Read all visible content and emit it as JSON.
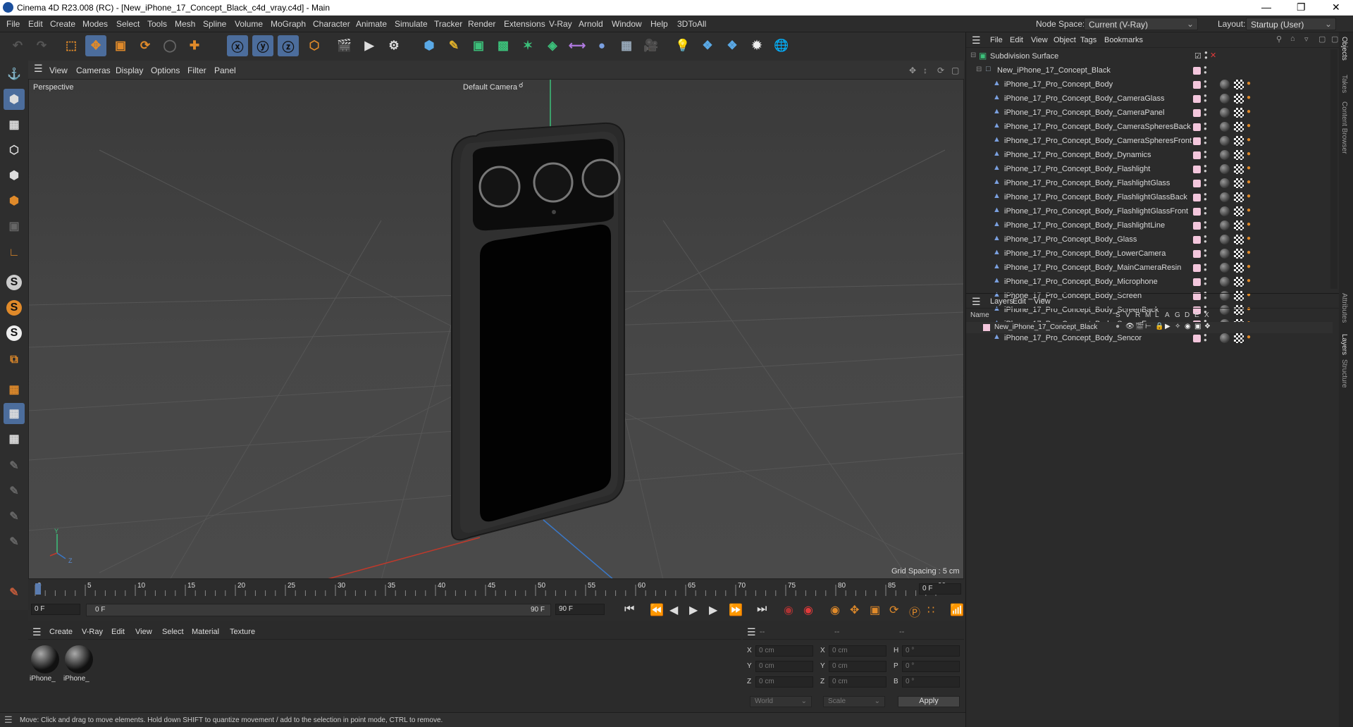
{
  "window": {
    "title": "Cinema 4D R23.008 (RC) - [New_iPhone_17_Concept_Black_c4d_vray.c4d] - Main"
  },
  "menu": [
    "File",
    "Edit",
    "Create",
    "Modes",
    "Select",
    "Tools",
    "Mesh",
    "Spline",
    "Volume",
    "MoGraph",
    "Character",
    "Animate",
    "Simulate",
    "Tracker",
    "Render",
    "Extensions",
    "V-Ray",
    "Arnold",
    "Window",
    "Help",
    "3DToAll"
  ],
  "node_space": {
    "label": "Node Space:",
    "value": "Current (V-Ray)"
  },
  "layout": {
    "label": "Layout:",
    "value": "Startup (User)"
  },
  "viewport_menu": [
    "View",
    "Cameras",
    "Display",
    "Options",
    "Filter",
    "Panel"
  ],
  "viewport": {
    "mode": "Perspective",
    "camera": "Default Camera",
    "grid_spacing": "Grid Spacing : 5 cm"
  },
  "timeline": {
    "ticks": [
      "0",
      "5",
      "10",
      "15",
      "20",
      "25",
      "30",
      "35",
      "40",
      "45",
      "50",
      "55",
      "60",
      "65",
      "70",
      "75",
      "80",
      "85",
      "90"
    ],
    "current_frame": "0 F",
    "start": "0 F",
    "range_start": "0 F",
    "range_end": "90 F",
    "end": "90 F"
  },
  "material_menu": [
    "Create",
    "V-Ray",
    "Edit",
    "View",
    "Select",
    "Material",
    "Texture"
  ],
  "materials": [
    "iPhone_",
    "iPhone_"
  ],
  "attributes": {
    "header": [
      "--",
      "--",
      "--"
    ],
    "rows": [
      {
        "a": "X",
        "av": "0 cm",
        "b": "X",
        "bv": "0 cm",
        "c": "H",
        "cv": "0 °"
      },
      {
        "a": "Y",
        "av": "0 cm",
        "b": "Y",
        "bv": "0 cm",
        "c": "P",
        "cv": "0 °"
      },
      {
        "a": "Z",
        "av": "0 cm",
        "b": "Z",
        "bv": "0 cm",
        "c": "B",
        "cv": "0 °"
      }
    ],
    "coord_system": "World",
    "mode": "Scale",
    "apply": "Apply"
  },
  "status": "Move: Click and drag to move elements. Hold down SHIFT to quantize movement / add to the selection in point mode, CTRL to remove.",
  "objects_menu": [
    "File",
    "Edit",
    "View",
    "Object",
    "Tags",
    "Bookmarks"
  ],
  "objects": {
    "root": "Subdivision Surface",
    "group": "New_iPhone_17_Concept_Black",
    "items": [
      "iPhone_17_Pro_Concept_Body",
      "iPhone_17_Pro_Concept_Body_CameraGlass",
      "iPhone_17_Pro_Concept_Body_CameraPanel",
      "iPhone_17_Pro_Concept_Body_CameraSpheresBack",
      "iPhone_17_Pro_Concept_Body_CameraSpheresFront",
      "iPhone_17_Pro_Concept_Body_Dynamics",
      "iPhone_17_Pro_Concept_Body_Flashlight",
      "iPhone_17_Pro_Concept_Body_FlashlightGlass",
      "iPhone_17_Pro_Concept_Body_FlashlightGlassBack",
      "iPhone_17_Pro_Concept_Body_FlashlightGlassFront",
      "iPhone_17_Pro_Concept_Body_FlashlightLine",
      "iPhone_17_Pro_Concept_Body_Glass",
      "iPhone_17_Pro_Concept_Body_LowerCamera",
      "iPhone_17_Pro_Concept_Body_MainCameraResin",
      "iPhone_17_Pro_Concept_Body_Microphone",
      "iPhone_17_Pro_Concept_Body_Screen",
      "iPhone_17_Pro_Concept_Body_ScreenBack",
      "iPhone_17_Pro_Concept_Body_ScreenFrames",
      "iPhone_17_Pro_Concept_Body_Sencor"
    ]
  },
  "layers_menu": [
    "Layers",
    "Edit",
    "View"
  ],
  "layers": {
    "columns": [
      "Name",
      "S",
      "V",
      "R",
      "M",
      "L",
      "A",
      "G",
      "D",
      "E",
      "X"
    ],
    "items": [
      "New_iPhone_17_Concept_Black"
    ]
  },
  "side_tabs": [
    "Objects",
    "Takes",
    "Content Browser",
    "Attributes",
    "Layers",
    "Structure"
  ],
  "colors": {
    "accent": "#4c6d9c",
    "layer_swatch": "#f3c6dc",
    "axis_y": "#3cc07a",
    "axis_x": "#c0392b",
    "axis_z": "#3a78c8"
  }
}
